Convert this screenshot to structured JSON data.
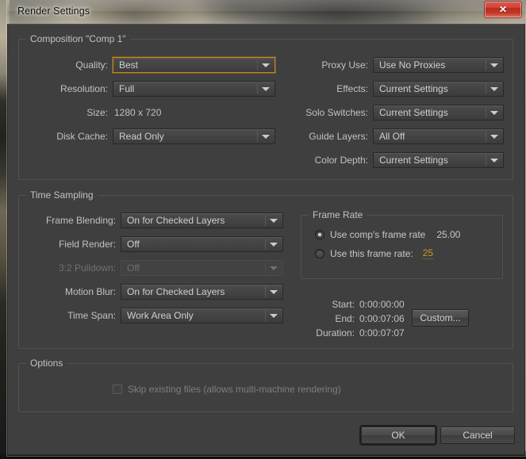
{
  "window": {
    "title": "Render Settings",
    "close_label": "✕",
    "close_icon": "close-icon"
  },
  "composition": {
    "group_title": "Composition \"Comp 1\"",
    "left_fields": [
      {
        "label": "Quality:",
        "value": "Best",
        "type": "dropdown",
        "focused": true,
        "disabled": false
      },
      {
        "label": "Resolution:",
        "value": "Full",
        "type": "dropdown",
        "focused": false,
        "disabled": false
      },
      {
        "label": "Size:",
        "value": "1280 x 720",
        "type": "static",
        "focused": false,
        "disabled": false
      },
      {
        "label": "Disk Cache:",
        "value": "Read Only",
        "type": "dropdown",
        "focused": false,
        "disabled": false
      }
    ],
    "right_fields": [
      {
        "label": "Proxy Use:",
        "value": "Use No Proxies",
        "type": "dropdown",
        "focused": false,
        "disabled": false
      },
      {
        "label": "Effects:",
        "value": "Current Settings",
        "type": "dropdown",
        "focused": false,
        "disabled": false
      },
      {
        "label": "Solo Switches:",
        "value": "Current Settings",
        "type": "dropdown",
        "focused": false,
        "disabled": false
      },
      {
        "label": "Guide Layers:",
        "value": "All Off",
        "type": "dropdown",
        "focused": false,
        "disabled": false
      },
      {
        "label": "Color Depth:",
        "value": "Current Settings",
        "type": "dropdown",
        "focused": false,
        "disabled": false
      }
    ]
  },
  "time_sampling": {
    "group_title": "Time Sampling",
    "fields": [
      {
        "label": "Frame Blending:",
        "value": "On for Checked Layers",
        "disabled": false
      },
      {
        "label": "Field Render:",
        "value": "Off",
        "disabled": false
      },
      {
        "label": "3:2 Pulldown:",
        "value": "Off",
        "disabled": true
      },
      {
        "label": "Motion Blur:",
        "value": "On for Checked Layers",
        "disabled": false
      },
      {
        "label": "Time Span:",
        "value": "Work Area Only",
        "disabled": false
      }
    ]
  },
  "frame_rate": {
    "group_title": "Frame Rate",
    "use_comp_label": "Use comp's frame rate",
    "use_comp_value": "25.00",
    "use_comp_selected": true,
    "use_this_label": "Use this frame rate:",
    "use_this_value": "25",
    "use_this_selected": false
  },
  "time_info": {
    "start_label": "Start:",
    "start_value": "0:00:00:00",
    "end_label": "End:",
    "end_value": "0:00:07:06",
    "duration_label": "Duration:",
    "duration_value": "0:00:07:07",
    "custom_button": "Custom..."
  },
  "options": {
    "group_title": "Options",
    "skip_existing_label": "Skip existing files (allows multi-machine rendering)",
    "skip_existing_checked": false,
    "skip_existing_disabled": true
  },
  "footer": {
    "ok_label": "OK",
    "cancel_label": "Cancel"
  },
  "colors": {
    "panel_bg": "#3f3f3f",
    "accent_focus": "#c68a15",
    "editable_value": "#d39a28",
    "close_red": "#c93c2d"
  }
}
